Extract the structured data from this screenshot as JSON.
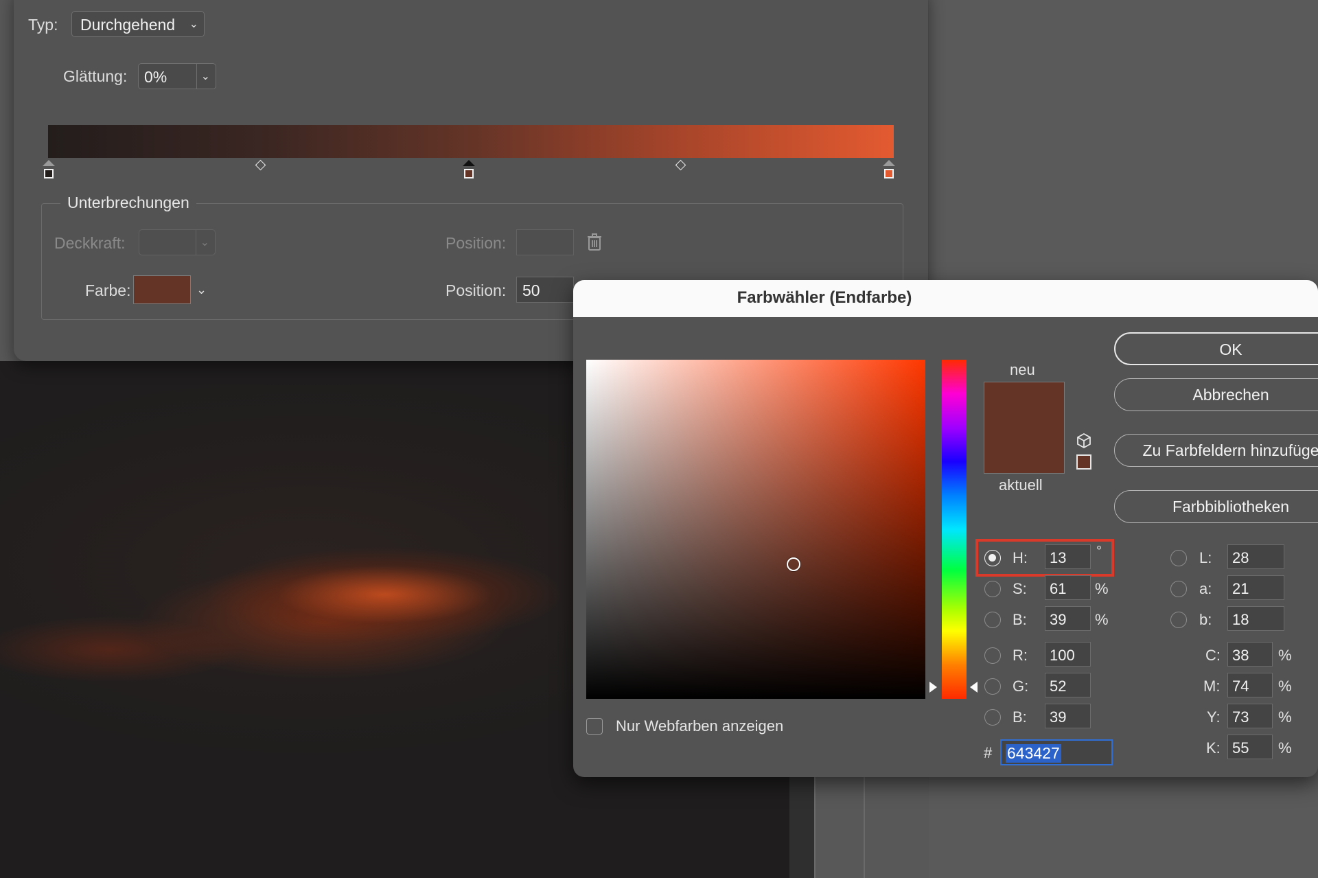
{
  "gradient_editor": {
    "type_label": "Typ:",
    "type_value": "Durchgehend",
    "smoothing_label": "Glättung:",
    "smoothing_value": "0%",
    "stops_group_title": "Unterbrechungen",
    "opacity_label": "Deckkraft:",
    "opacity_value": "",
    "opacity_position_label": "Position:",
    "opacity_position_value": "",
    "color_label": "Farbe:",
    "color_position_label": "Position:",
    "color_position_value": "50",
    "stop_colors": [
      "#231d1c",
      "#643427",
      "#e35a30"
    ]
  },
  "color_picker": {
    "title": "Farbwähler (Endfarbe)",
    "new_label": "neu",
    "current_label": "aktuell",
    "new_color": "#643427",
    "current_color": "#643427",
    "ok_label": "OK",
    "cancel_label": "Abbrechen",
    "add_to_swatches_label": "Zu Farbfeldern hinzufüge",
    "color_libraries_label": "Farbbibliotheken",
    "web_colors_label": "Nur Webfarben anzeigen",
    "web_colors_checked": false,
    "hsb": {
      "h_label": "H:",
      "h": "13",
      "h_unit": "°",
      "s_label": "S:",
      "s": "61",
      "s_unit": "%",
      "b_label": "B:",
      "b": "39",
      "b_unit": "%"
    },
    "rgb": {
      "r_label": "R:",
      "r": "100",
      "g_label": "G:",
      "g": "52",
      "b_label": "B:",
      "b": "39"
    },
    "lab": {
      "l_label": "L:",
      "l": "28",
      "a_label": "a:",
      "a": "21",
      "b_label": "b:",
      "b": "18"
    },
    "cmyk": {
      "c_label": "C:",
      "c": "38",
      "c_unit": "%",
      "m_label": "M:",
      "m": "74",
      "m_unit": "%",
      "y_label": "Y:",
      "y": "73",
      "y_unit": "%",
      "k_label": "K:",
      "k": "55",
      "k_unit": "%"
    },
    "hex_label": "#",
    "hex": "643427",
    "selected_mode": "H",
    "highlight_color": "#d93a2a"
  },
  "icons": {
    "trash": "trash-icon",
    "chevron": "chevron-down-icon",
    "gamut": "cube-warning-icon"
  }
}
